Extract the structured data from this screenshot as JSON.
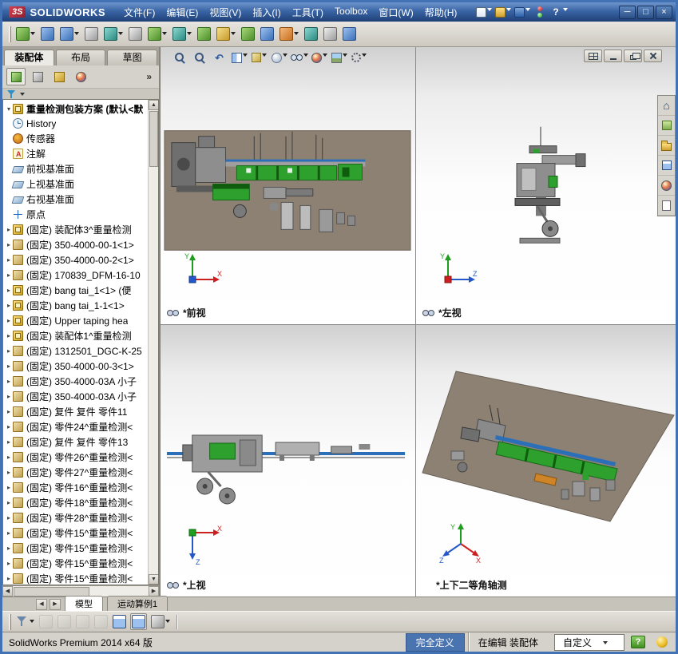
{
  "titlebar": {
    "logo": "3S",
    "brand": "SOLIDWORKS",
    "menus": [
      "文件(F)",
      "编辑(E)",
      "视图(V)",
      "插入(I)",
      "工具(T)",
      "Toolbox",
      "窗口(W)",
      "帮助(H)"
    ],
    "help": "?"
  },
  "window_controls": {
    "minimize": "─",
    "maximize": "□",
    "close": "×"
  },
  "title_tools": {
    "icons": [
      {
        "b": "new-document-button",
        "ic": "new-document-icon",
        "c": "page",
        "caret": "1"
      },
      {
        "b": "open-document-button",
        "ic": "open-folder-icon",
        "c": "folder",
        "caret": "1"
      },
      {
        "b": "save-button",
        "ic": "save-disk-icon",
        "c": "disk",
        "caret": "1"
      }
    ]
  },
  "main_toolbar": {
    "icons": [
      {
        "b": "insert-components-button",
        "ic": "insert-components-icon",
        "c": "green",
        "caret": "1"
      },
      {
        "b": "mate-button",
        "ic": "mate-icon",
        "c": "blue",
        "caret": ""
      },
      {
        "b": "linear-component-pattern-button",
        "ic": "linear-pattern-icon",
        "c": "blue",
        "caret": "1"
      },
      {
        "b": "smart-fasteners-button",
        "ic": "smart-fasteners-icon",
        "c": "gray",
        "caret": ""
      },
      {
        "b": "move-component-button",
        "ic": "move-component-icon",
        "c": "teal",
        "caret": "1"
      },
      {
        "b": "show-hidden-components-button",
        "ic": "show-hidden-icon",
        "c": "gray",
        "caret": ""
      },
      {
        "b": "assembly-features-button",
        "ic": "assembly-features-icon",
        "c": "green",
        "caret": "1"
      },
      {
        "b": "reference-geometry-button",
        "ic": "reference-geometry-icon",
        "c": "teal",
        "caret": "1"
      },
      {
        "b": "new-motion-study-button",
        "ic": "motion-study-icon",
        "c": "green",
        "caret": ""
      },
      {
        "b": "bill-of-materials-button",
        "ic": "bom-icon",
        "c": "yellow",
        "caret": "1"
      },
      {
        "b": "exploded-view-button",
        "ic": "exploded-view-icon",
        "c": "green",
        "caret": ""
      },
      {
        "b": "explode-line-sketch-button",
        "ic": "explode-line-icon",
        "c": "blue",
        "caret": ""
      },
      {
        "b": "interference-detection-button",
        "ic": "interference-icon",
        "c": "orange",
        "caret": "1"
      },
      {
        "b": "measure-button",
        "ic": "measure-icon",
        "c": "teal",
        "caret": ""
      },
      {
        "b": "mass-properties-button",
        "ic": "mass-properties-icon",
        "c": "gray",
        "caret": ""
      },
      {
        "b": "instant3d-button",
        "ic": "instant3d-icon",
        "c": "blue",
        "caret": ""
      }
    ]
  },
  "hud": {
    "icons": [
      {
        "b": "zoom-to-fit-button",
        "ic": "zoom-to-fit-icon",
        "c": "mag",
        "g": "",
        "caret": ""
      },
      {
        "b": "zoom-to-area-button",
        "ic": "zoom-to-area-icon",
        "c": "mag",
        "g": "",
        "caret": ""
      },
      {
        "b": "previous-view-button",
        "ic": "previous-view-icon",
        "c": "undo",
        "g": "↶",
        "caret": ""
      },
      {
        "b": "section-view-button",
        "ic": "section-view-icon",
        "c": "section",
        "g": "",
        "caret": "1"
      },
      {
        "b": "view-orientation-button",
        "ic": "view-orientation-icon",
        "c": "cube",
        "g": "",
        "caret": "1"
      },
      {
        "b": "display-style-button",
        "ic": "display-style-icon",
        "c": "sphere",
        "g": "",
        "caret": "1"
      },
      {
        "b": "hide-show-items-button",
        "ic": "hide-show-items-icon",
        "c": "glasses",
        "g": "",
        "caret": "1"
      },
      {
        "b": "edit-appearance-button",
        "ic": "edit-appearance-icon",
        "c": "ball",
        "g": "",
        "caret": "1"
      },
      {
        "b": "apply-scene-button",
        "ic": "apply-scene-icon",
        "c": "scene",
        "g": "",
        "caret": "1"
      },
      {
        "b": "view-settings-button",
        "ic": "view-settings-icon",
        "c": "gear",
        "g": "",
        "caret": "1"
      }
    ]
  },
  "fm": {
    "tabs": [
      {
        "b": "featuremanager-tree-tab",
        "ic": "featuremanager-tree-icon",
        "c": "tree-green",
        "p": "1"
      },
      {
        "b": "propertymanager-tab",
        "ic": "propertymanager-icon",
        "c": "wrench",
        "p": ""
      },
      {
        "b": "configurationmanager-tab",
        "ic": "configurationmanager-icon",
        "c": "config",
        "p": ""
      },
      {
        "b": "displaymanager-tab",
        "ic": "displaymanager-icon",
        "c": "ball",
        "p": ""
      }
    ],
    "more": "»"
  },
  "panel_tabs": [
    "装配体",
    "布局",
    "草图"
  ],
  "tree": {
    "root_arrow": "▾",
    "root": "重量检测包装方案 (默认<默",
    "items": [
      {
        "a": "",
        "i": "history",
        "l": "History"
      },
      {
        "a": "",
        "i": "sensor",
        "l": "传感器"
      },
      {
        "a": "",
        "i": "annotation",
        "l": "注解"
      },
      {
        "a": "",
        "i": "plane",
        "l": "前视基准面"
      },
      {
        "a": "",
        "i": "plane",
        "l": "上视基准面"
      },
      {
        "a": "",
        "i": "plane",
        "l": "右视基准面"
      },
      {
        "a": "",
        "i": "origin",
        "l": "原点"
      },
      {
        "a": "▸",
        "i": "assembly",
        "l": "(固定) 装配体3^重量检测"
      },
      {
        "a": "▸",
        "i": "part",
        "l": "(固定) 350-4000-00-1<1>"
      },
      {
        "a": "▸",
        "i": "part",
        "l": "(固定) 350-4000-00-2<1>"
      },
      {
        "a": "▸",
        "i": "part",
        "l": "(固定) 170839_DFM-16-10"
      },
      {
        "a": "▸",
        "i": "assembly",
        "l": "(固定) bang tai_1<1> (便"
      },
      {
        "a": "▸",
        "i": "assembly",
        "l": "(固定) bang tai_1-1<1>"
      },
      {
        "a": "▸",
        "i": "assembly",
        "l": "(固定) Upper taping hea"
      },
      {
        "a": "▸",
        "i": "assembly",
        "l": "(固定) 装配体1^重量检测"
      },
      {
        "a": "▸",
        "i": "part",
        "l": "(固定) 1312501_DGC-K-25"
      },
      {
        "a": "▸",
        "i": "part",
        "l": "(固定) 350-4000-00-3<1>"
      },
      {
        "a": "▸",
        "i": "part",
        "l": "(固定) 350-4000-03A 小子"
      },
      {
        "a": "▸",
        "i": "part",
        "l": "(固定) 350-4000-03A 小子"
      },
      {
        "a": "▸",
        "i": "part",
        "l": "(固定) 复件 复件 零件11"
      },
      {
        "a": "▸",
        "i": "part",
        "l": "(固定) 零件24^重量检测<"
      },
      {
        "a": "▸",
        "i": "part",
        "l": "(固定) 复件 复件 零件13"
      },
      {
        "a": "▸",
        "i": "part",
        "l": "(固定) 零件26^重量检测<"
      },
      {
        "a": "▸",
        "i": "part",
        "l": "(固定) 零件27^重量检测<"
      },
      {
        "a": "▸",
        "i": "part",
        "l": "(固定) 零件16^重量检测<"
      },
      {
        "a": "▸",
        "i": "part",
        "l": "(固定) 零件18^重量检测<"
      },
      {
        "a": "▸",
        "i": "part",
        "l": "(固定) 零件28^重量检测<"
      },
      {
        "a": "▸",
        "i": "part",
        "l": "(固定) 零件15^重量检测<"
      },
      {
        "a": "▸",
        "i": "part",
        "l": "(固定) 零件15^重量检测<"
      },
      {
        "a": "▸",
        "i": "part",
        "l": "(固定) 零件15^重量检测<"
      },
      {
        "a": "▸",
        "i": "part",
        "l": "(固定) 零件15^重量检测<"
      }
    ]
  },
  "viewports": [
    {
      "label": "*前视",
      "axes": [
        "Y",
        "X"
      ]
    },
    {
      "label": "*左视",
      "axes": [
        "Y",
        "Z"
      ]
    },
    {
      "label": "*上视",
      "axes": [
        "X",
        "Z"
      ]
    },
    {
      "label": "*上下二等角轴测",
      "axes": [
        "Y",
        "X",
        "Z"
      ]
    }
  ],
  "model_tabs": [
    "模型",
    "运动算例1"
  ],
  "sel": {
    "icons": [
      {
        "b": "selection-filter-button",
        "ic": "selection-filter-icon",
        "c": "funnel",
        "caret": "1",
        "dis": "",
        "p": ""
      },
      {
        "b": "filter-vertices-button",
        "ic": "filter-vertices-icon",
        "c": "pale",
        "caret": "",
        "dis": "1",
        "p": ""
      },
      {
        "b": "filter-edges-button",
        "ic": "filter-edges-icon",
        "c": "pale",
        "caret": "",
        "dis": "1",
        "p": ""
      },
      {
        "b": "filter-faces-button",
        "ic": "filter-faces-icon",
        "c": "pale",
        "caret": "",
        "dis": "1",
        "p": ""
      },
      {
        "b": "clear-filters-button",
        "ic": "clear-filters-icon",
        "c": "pale",
        "caret": "",
        "dis": "1",
        "p": ""
      },
      {
        "b": "single-view-button",
        "ic": "single-view-icon",
        "c": "bluewin",
        "caret": "",
        "dis": "",
        "p": ""
      },
      {
        "b": "four-view-button",
        "ic": "four-view-icon",
        "c": "bluewin",
        "caret": "",
        "dis": "",
        "p": "1"
      },
      {
        "b": "display-pane-button",
        "ic": "display-pane-icon",
        "c": "gray",
        "caret": "1",
        "dis": "",
        "p": ""
      }
    ]
  },
  "taskpane": {
    "icons": [
      {
        "b": "solidworks-resources-tab",
        "ic": "home-icon",
        "c": "home",
        "g": "⌂"
      },
      {
        "b": "design-library-tab",
        "ic": "design-library-icon",
        "c": "stack",
        "g": ""
      },
      {
        "b": "file-explorer-tab",
        "ic": "file-explorer-icon",
        "c": "folder",
        "g": ""
      },
      {
        "b": "view-palette-tab",
        "ic": "view-palette-icon",
        "c": "bluewin",
        "g": ""
      },
      {
        "b": "appearances-tab",
        "ic": "appearances-icon",
        "c": "ball",
        "g": ""
      },
      {
        "b": "custom-properties-tab",
        "ic": "custom-properties-icon",
        "c": "doc",
        "g": ""
      }
    ]
  },
  "scroll": {
    "left": "◀",
    "right": "▶",
    "up": "▲",
    "down": "▼"
  },
  "statusbar": {
    "product": "SolidWorks Premium 2014 x64 版",
    "defined": "完全定义",
    "editing": "在编辑 装配体",
    "custom": "自定义",
    "help": "?"
  }
}
